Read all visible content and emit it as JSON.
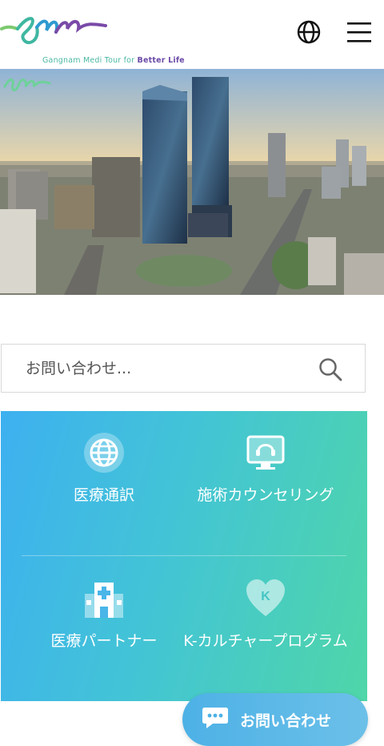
{
  "header": {
    "logo_tagline_prefix": "Gangnam Medi Tour for",
    "logo_tagline_bold": "Better Life",
    "icons": [
      "globe-icon",
      "hamburger-menu-icon"
    ]
  },
  "search": {
    "placeholder": "お問い合わせ..."
  },
  "services": [
    {
      "label": "医療通訳",
      "icon": "globe-icon"
    },
    {
      "label": "施術カウンセリング",
      "icon": "headset-monitor-icon"
    },
    {
      "label": "医療パートナー",
      "icon": "hospital-icon"
    },
    {
      "label": "K-カルチャープログラム",
      "icon": "heart-k-icon"
    }
  ],
  "chat_button": {
    "label": "お問い合わせ",
    "icon": "chat-bubble-icon"
  },
  "colors": {
    "gradient_start": "#3db0f0",
    "gradient_end": "#4fd6a8",
    "fab": "#4db1e6"
  }
}
